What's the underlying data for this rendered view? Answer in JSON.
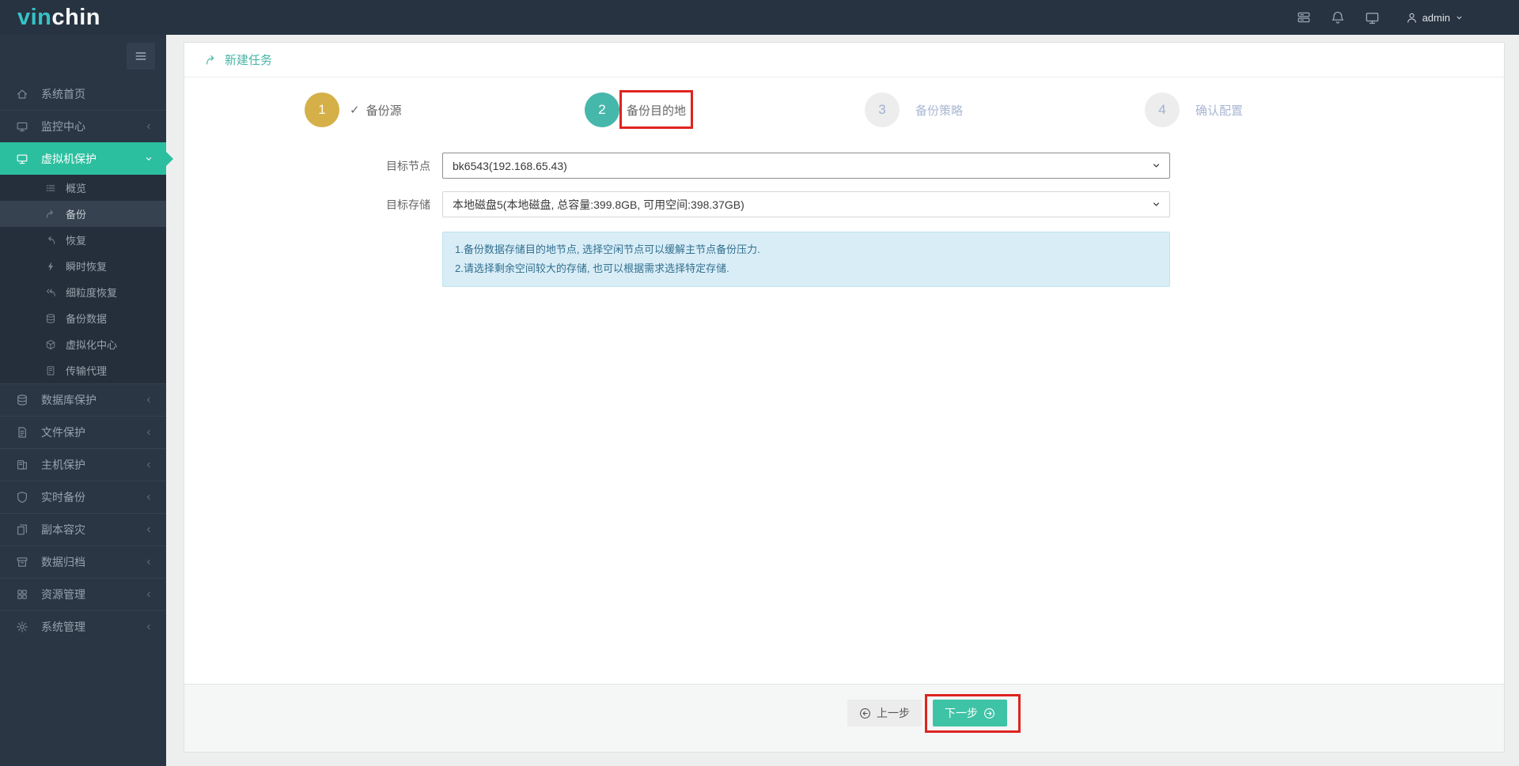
{
  "header": {
    "logo_part1": "vin",
    "logo_part2": "chin",
    "username": "admin",
    "icons": [
      "server-list-icon",
      "bell-icon",
      "display-icon",
      "user-icon",
      "chevron-down-icon"
    ]
  },
  "sidebar": {
    "hamburger_icon": "menu-icon",
    "items": [
      {
        "slug": "system-home",
        "label": "系统首页",
        "icon": "home-icon",
        "type": "top",
        "chevron": ""
      },
      {
        "slug": "monitor-center",
        "label": "监控中心",
        "icon": "monitor-icon",
        "type": "top",
        "chevron": "left"
      },
      {
        "slug": "vm-protection",
        "label": "虚拟机保护",
        "icon": "desktop-icon",
        "type": "top",
        "chevron": "down",
        "active": true
      },
      {
        "slug": "overview",
        "label": "概览",
        "icon": "list-icon",
        "type": "sub",
        "chevron": ""
      },
      {
        "slug": "backup",
        "label": "备份",
        "icon": "forward-arrow-icon",
        "type": "sub",
        "chevron": "",
        "active_sub": true
      },
      {
        "slug": "restore",
        "label": "恢复",
        "icon": "reply-arrow-icon",
        "type": "sub",
        "chevron": ""
      },
      {
        "slug": "instant-restore",
        "label": "瞬时恢复",
        "icon": "bolt-icon",
        "type": "sub",
        "chevron": ""
      },
      {
        "slug": "granular-restore",
        "label": "细粒度恢复",
        "icon": "reply-all-icon",
        "type": "sub",
        "chevron": ""
      },
      {
        "slug": "backup-data",
        "label": "备份数据",
        "icon": "database-icon",
        "type": "sub",
        "chevron": ""
      },
      {
        "slug": "virtualization-center",
        "label": "虚拟化中心",
        "icon": "cube-icon",
        "type": "sub",
        "chevron": ""
      },
      {
        "slug": "transfer-agent",
        "label": "传输代理",
        "icon": "server-icon",
        "type": "sub",
        "chevron": ""
      },
      {
        "slug": "database-protection",
        "label": "数据库保护",
        "icon": "database-icon",
        "type": "top",
        "chevron": "left"
      },
      {
        "slug": "file-protection",
        "label": "文件保护",
        "icon": "file-icon",
        "type": "top",
        "chevron": "left"
      },
      {
        "slug": "host-protection",
        "label": "主机保护",
        "icon": "host-icon",
        "type": "top",
        "chevron": "left"
      },
      {
        "slug": "realtime-backup",
        "label": "实时备份",
        "icon": "shield-icon",
        "type": "top",
        "chevron": "left"
      },
      {
        "slug": "replica-dr",
        "label": "副本容灾",
        "icon": "copy-icon",
        "type": "top",
        "chevron": "left"
      },
      {
        "slug": "data-archive",
        "label": "数据归档",
        "icon": "archive-icon",
        "type": "top",
        "chevron": "left"
      },
      {
        "slug": "resource-management",
        "label": "资源管理",
        "icon": "grid-icon",
        "type": "top",
        "chevron": "left"
      },
      {
        "slug": "system-management",
        "label": "系统管理",
        "icon": "gear-icon",
        "type": "top",
        "chevron": "left"
      }
    ]
  },
  "breadcrumb": {
    "icon": "forward-arrow-icon",
    "title": "新建任务"
  },
  "wizard": {
    "steps": [
      {
        "slug": "backup-source",
        "num": "1",
        "label": "备份源",
        "state": "done",
        "checked": true
      },
      {
        "slug": "backup-destination",
        "num": "2",
        "label": "备份目的地",
        "state": "active",
        "highlighted": true
      },
      {
        "slug": "backup-strategy",
        "num": "3",
        "label": "备份策略",
        "state": "pending"
      },
      {
        "slug": "confirm-config",
        "num": "4",
        "label": "确认配置",
        "state": "pending"
      }
    ]
  },
  "form": {
    "fields": [
      {
        "label": "目标节点",
        "value": "bk6543(192.168.65.43)",
        "chevron_icon": "chevron-down-icon"
      },
      {
        "label": "目标存储",
        "value": "本地磁盘5(本地磁盘, 总容量:399.8GB, 可用空间:398.37GB)",
        "chevron_icon": "chevron-down-icon"
      }
    ],
    "info_lines": [
      "1.备份数据存储目的地节点, 选择空闲节点可以缓解主节点备份压力.",
      "2.请选择剩余空间较大的存储, 也可以根据需求选择特定存储."
    ]
  },
  "footer": {
    "prev_label": "上一步",
    "prev_icon": "arrow-circle-left-icon",
    "next_label": "下一步",
    "next_icon": "arrow-circle-right-icon",
    "next_highlighted": true
  },
  "colors": {
    "accent_teal": "#2cbf9f",
    "step_done_gold": "#d5b049",
    "step_active_teal": "#46b7ab",
    "next_button": "#3fc3a6",
    "annotation_red": "#de241f",
    "info_bg": "#d9edf7",
    "info_text": "#31708f",
    "topbar_bg": "#273340",
    "sidebar_bg": "#2a3644"
  }
}
